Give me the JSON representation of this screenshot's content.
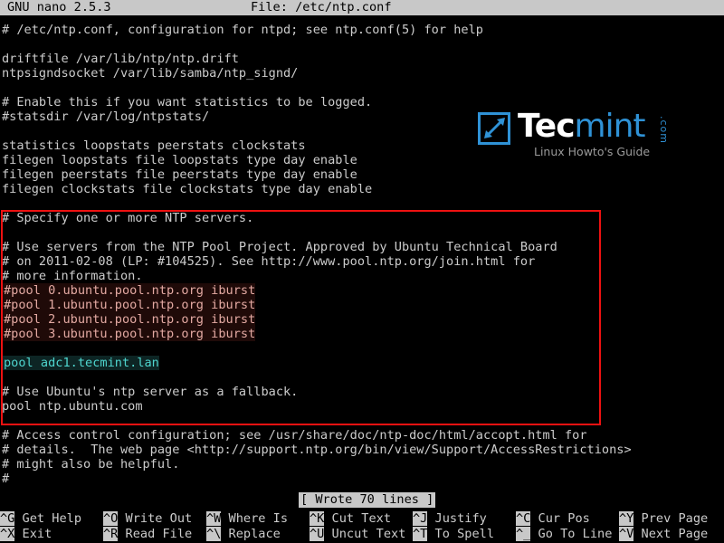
{
  "window": {
    "app": "GNU nano 2.5.3",
    "file_label": "File: /etc/ntp.conf"
  },
  "editor": {
    "lines": [
      {
        "text": "# /etc/ntp.conf, configuration for ntpd; see ntp.conf(5) for help",
        "style": "plain"
      },
      {
        "text": "",
        "style": "plain"
      },
      {
        "text": "driftfile /var/lib/ntp/ntp.drift",
        "style": "plain"
      },
      {
        "text": "ntpsigndsocket /var/lib/samba/ntp_signd/",
        "style": "plain"
      },
      {
        "text": "",
        "style": "plain"
      },
      {
        "text": "# Enable this if you want statistics to be logged.",
        "style": "plain"
      },
      {
        "text": "#statsdir /var/log/ntpstats/",
        "style": "plain"
      },
      {
        "text": "",
        "style": "plain"
      },
      {
        "text": "statistics loopstats peerstats clockstats",
        "style": "plain"
      },
      {
        "text": "filegen loopstats file loopstats type day enable",
        "style": "plain"
      },
      {
        "text": "filegen peerstats file peerstats type day enable",
        "style": "plain"
      },
      {
        "text": "filegen clockstats file clockstats type day enable",
        "style": "plain"
      },
      {
        "text": "",
        "style": "plain"
      },
      {
        "text": "# Specify one or more NTP servers.",
        "style": "plain"
      },
      {
        "text": "",
        "style": "plain"
      },
      {
        "text": "# Use servers from the NTP Pool Project. Approved by Ubuntu Technical Board",
        "style": "plain"
      },
      {
        "text": "# on 2011-02-08 (LP: #104525). See http://www.pool.ntp.org/join.html for",
        "style": "plain"
      },
      {
        "text": "# more information.",
        "style": "plain"
      },
      {
        "text": "#pool 0.ubuntu.pool.ntp.org iburst",
        "style": "hl-red"
      },
      {
        "text": "#pool 1.ubuntu.pool.ntp.org iburst",
        "style": "hl-red"
      },
      {
        "text": "#pool 2.ubuntu.pool.ntp.org iburst",
        "style": "hl-red"
      },
      {
        "text": "#pool 3.ubuntu.pool.ntp.org iburst",
        "style": "hl-red"
      },
      {
        "text": "",
        "style": "plain"
      },
      {
        "text": "pool adc1.tecmint.lan",
        "style": "hl-teal"
      },
      {
        "text": "",
        "style": "plain"
      },
      {
        "text": "# Use Ubuntu's ntp server as a fallback.",
        "style": "plain"
      },
      {
        "text": "pool ntp.ubuntu.com",
        "style": "plain"
      },
      {
        "text": "",
        "style": "plain"
      },
      {
        "text": "# Access control configuration; see /usr/share/doc/ntp-doc/html/accopt.html for",
        "style": "plain"
      },
      {
        "text": "# details.  The web page <http://support.ntp.org/bin/view/Support/AccessRestrictions>",
        "style": "plain"
      },
      {
        "text": "# might also be helpful.",
        "style": "plain"
      },
      {
        "text": "#",
        "style": "plain"
      }
    ]
  },
  "annotation": {
    "highlight_color": "#ee1111"
  },
  "logo": {
    "mark": "expand-arrow-icon",
    "word_primary": "Tec",
    "word_secondary": "mint",
    "dotcom": ".com",
    "tagline": "Linux Howto's Guide",
    "brand_blue": "#2f92d6"
  },
  "status": {
    "message": "[ Wrote 70 lines ]"
  },
  "shortcuts": {
    "row1": [
      {
        "key": "^G",
        "label": "Get Help"
      },
      {
        "key": "^O",
        "label": "Write Out"
      },
      {
        "key": "^W",
        "label": "Where Is"
      },
      {
        "key": "^K",
        "label": "Cut Text"
      },
      {
        "key": "^J",
        "label": "Justify"
      },
      {
        "key": "^C",
        "label": "Cur Pos"
      },
      {
        "key": "^Y",
        "label": "Prev Page"
      }
    ],
    "row2": [
      {
        "key": "^X",
        "label": "Exit"
      },
      {
        "key": "^R",
        "label": "Read File"
      },
      {
        "key": "^\\",
        "label": "Replace"
      },
      {
        "key": "^U",
        "label": "Uncut Text"
      },
      {
        "key": "^T",
        "label": "To Spell"
      },
      {
        "key": "^_",
        "label": "Go To Line"
      },
      {
        "key": "^V",
        "label": "Next Page"
      }
    ]
  }
}
